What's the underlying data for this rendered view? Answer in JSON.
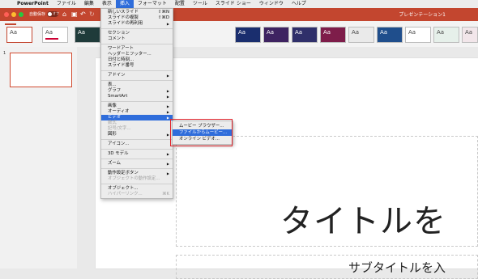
{
  "menubar": {
    "apple": "",
    "app": "PowerPoint",
    "items": [
      "ファイル",
      "編集",
      "表示",
      "挿入",
      "フォーマット",
      "配置",
      "ツール",
      "スライド ショー",
      "ウィンドウ",
      "ヘルプ"
    ]
  },
  "titlebar": {
    "autosave": "自動保存",
    "toggle": "オフ",
    "title": "プレゼンテーション1"
  },
  "ribbon": {
    "themes": [
      "Aa",
      "Aa",
      "Aa",
      "Aa",
      "Aa",
      "Aa",
      "Aa",
      "Aa",
      "Aa",
      "Aa",
      "Aa",
      "Aa"
    ]
  },
  "slides_pane": {
    "number": "1"
  },
  "slide": {
    "title": "タイトルを",
    "subtitle": "サブタイトルを入"
  },
  "insert_menu": {
    "new_slide": "新しいスライド",
    "new_slide_sc": "⇧⌘N",
    "duplicate_slide": "スライドの複製",
    "duplicate_slide_sc": "⇧⌘D",
    "reuse_slide": "スライドの再利用",
    "section": "セクション",
    "comment": "コメント",
    "wordart": "ワードアート",
    "header_footer": "ヘッダーとフッター...",
    "date_time": "日付と時刻...",
    "slide_number": "スライド番号",
    "addins": "アドイン",
    "table": "表...",
    "chart": "グラフ",
    "smartart": "SmartArt",
    "picture": "画像",
    "audio": "オーディオ",
    "video": "ビデオ",
    "equation": "数式",
    "symbol": "記号/文字...",
    "shape": "図形",
    "icons": "アイコン...",
    "model3d": "3D モデル",
    "zoom": "ズーム",
    "action_button": "動作設定ボタン",
    "object_action": "オブジェクトの動作設定...",
    "object": "オブジェクト...",
    "hyperlink": "ハイパーリンク...",
    "hyperlink_sc": "⌘K"
  },
  "video_submenu": {
    "browser": "ムービー ブラウザー...",
    "from_file": "ファイルからムービー...",
    "online": "オンライン ビデオ..."
  },
  "colors": {
    "accent": "#c3462f",
    "highlight": "#2f6ddb",
    "annotation": "#e0262d"
  }
}
